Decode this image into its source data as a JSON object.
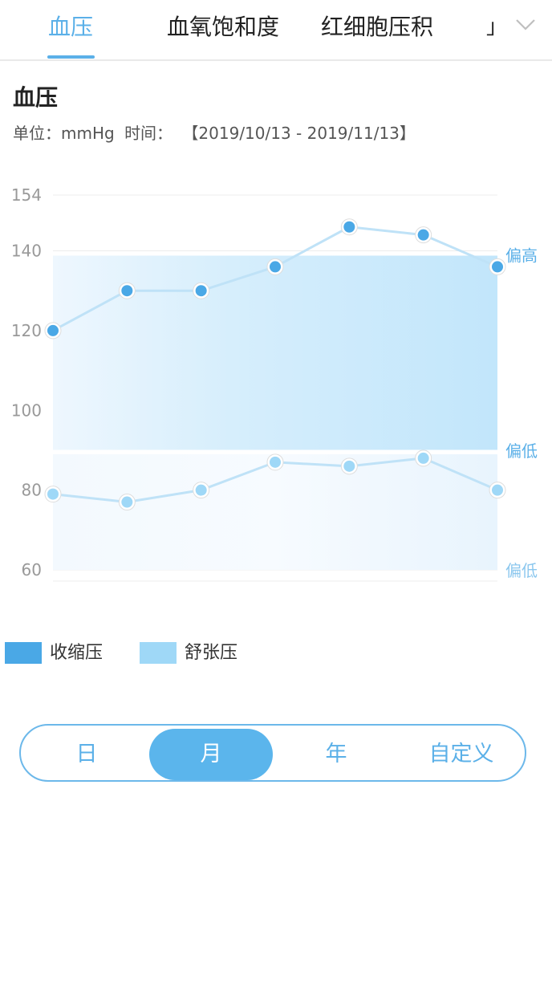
{
  "tabs": [
    {
      "label": "血压",
      "active": true
    },
    {
      "label": "血氧饱和度",
      "active": false
    },
    {
      "label": "红细胞压积",
      "active": false
    }
  ],
  "tab_overflow_label": "」",
  "icons": {
    "expand": "chevron-down-icon"
  },
  "page": {
    "title": "血压",
    "unit_label": "单位：mmHg",
    "time_label": "时间：",
    "time_range": "【2019/10/13 - 2019/11/13】"
  },
  "colors": {
    "accent": "#5bb0e8",
    "systolic": "#4aa8e6",
    "diastolic": "#9fd8f7",
    "band": "#c5e8fb"
  },
  "chart_data": {
    "type": "line",
    "title": "",
    "xlabel": "",
    "ylabel": "",
    "ylim": [
      60,
      154
    ],
    "y_ticks": [
      154,
      140,
      120,
      100,
      80,
      60
    ],
    "x": [
      1,
      2,
      3,
      4,
      5,
      6,
      7
    ],
    "series": [
      {
        "name": "收缩压",
        "values": [
          120,
          130,
          130,
          136,
          146,
          144,
          136
        ]
      },
      {
        "name": "舒张压",
        "values": [
          79,
          77,
          80,
          87,
          86,
          88,
          80
        ]
      }
    ],
    "bands": [
      {
        "from": 90,
        "to": 139,
        "label_top": "偏高",
        "label_bottom": "偏低"
      },
      {
        "from": 60,
        "to": 89,
        "label_bottom": "偏低"
      }
    ],
    "grid": true,
    "legend_position": "bottom-left"
  },
  "legend": [
    {
      "label": "收缩压",
      "color": "#4aa8e6"
    },
    {
      "label": "舒张压",
      "color": "#9fd8f7"
    }
  ],
  "period_selector": {
    "options": [
      "日",
      "月",
      "年",
      "自定义"
    ],
    "selected": "月"
  }
}
